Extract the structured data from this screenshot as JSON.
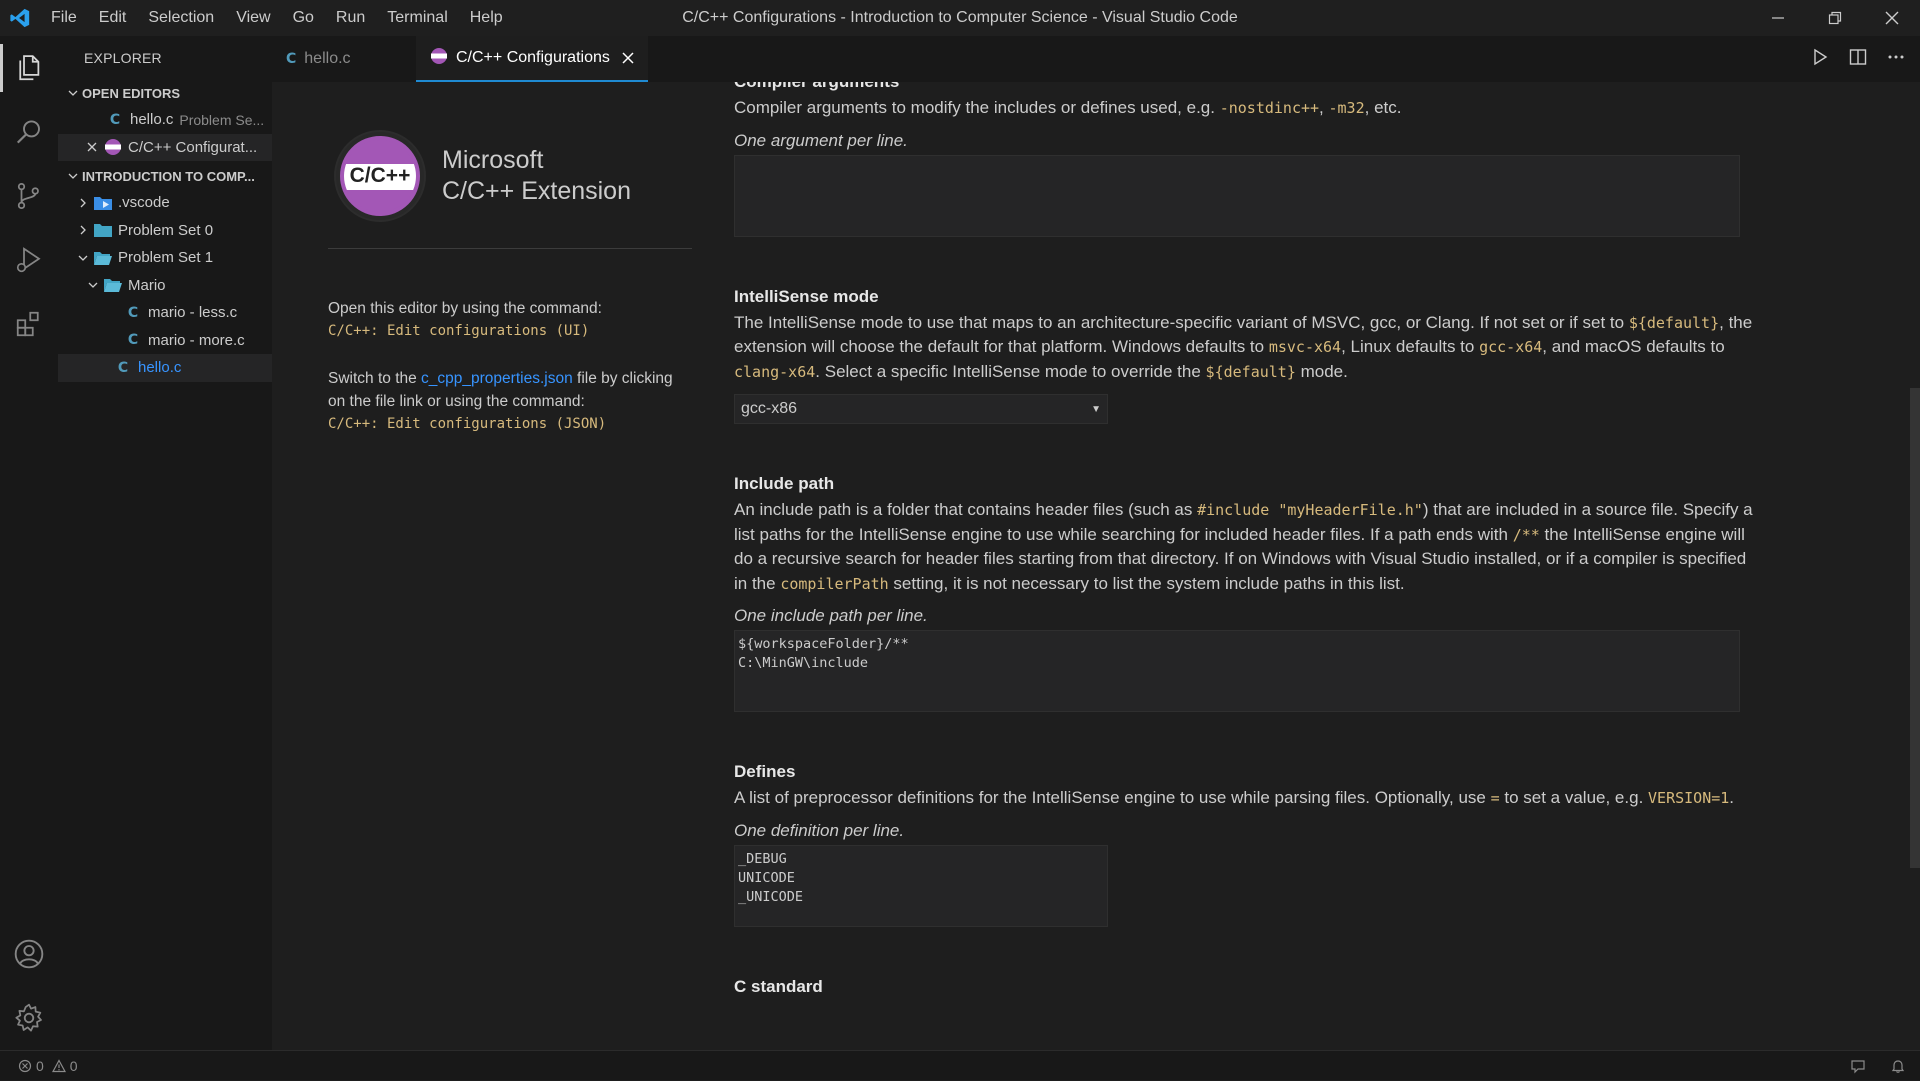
{
  "window": {
    "title": "C/C++ Configurations - Introduction to Computer Science - Visual Studio Code",
    "menu": [
      "File",
      "Edit",
      "Selection",
      "View",
      "Go",
      "Run",
      "Terminal",
      "Help"
    ]
  },
  "sidebar": {
    "title": "EXPLORER",
    "open_editors_header": "OPEN EDITORS",
    "open_editors": [
      {
        "name": "hello.c",
        "detail": "Problem Se..."
      },
      {
        "name": "C/C++ Configurat..."
      }
    ],
    "workspace_header": "INTRODUCTION TO COMP...",
    "tree": [
      {
        "label": ".vscode"
      },
      {
        "label": "Problem Set 0"
      },
      {
        "label": "Problem Set 1"
      },
      {
        "label": "Mario"
      },
      {
        "label": "mario - less.c"
      },
      {
        "label": "mario - more.c"
      },
      {
        "label": "hello.c"
      }
    ]
  },
  "tabs": [
    {
      "label": "hello.c"
    },
    {
      "label": "C/C++ Configurations"
    }
  ],
  "extension": {
    "logo_text": "C/C++",
    "name_line1": "Microsoft",
    "name_line2": "C/C++ Extension",
    "para1": "Open this editor by using the command:",
    "para1_cmd": "C/C++: Edit configurations (UI)",
    "para2_pre": "Switch to the ",
    "para2_link": "c_cpp_properties.json",
    "para2_post": " file by clicking on the file link or using the command:",
    "para2_cmd": "C/C++: Edit configurations (JSON)"
  },
  "settings": {
    "compiler_args": {
      "title": "Compiler arguments",
      "desc_pre": "Compiler arguments to modify the includes or defines used, e.g. ",
      "code1": "-nostdinc++",
      "sep": ", ",
      "code2": "-m32",
      "desc_post": ", etc.",
      "hint": "One argument per line.",
      "value": ""
    },
    "intellisense": {
      "title": "IntelliSense mode",
      "t1": "The IntelliSense mode to use that maps to an architecture-specific variant of MSVC, gcc, or Clang. If not set or if set to ",
      "c1": "${default}",
      "t2": ", the extension will choose the default for that platform. Windows defaults to ",
      "c2": "msvc-x64",
      "t3": ", Linux defaults to ",
      "c3": "gcc-x64",
      "t4": ", and macOS defaults to ",
      "c4": "clang-x64",
      "t5": ". Select a specific IntelliSense mode to override the ",
      "c5": "${default}",
      "t6": " mode.",
      "selected": "gcc-x86"
    },
    "include_path": {
      "title": "Include path",
      "t1": "An include path is a folder that contains header files (such as ",
      "c1": "#include \"myHeaderFile.h\"",
      "t2": ") that are included in a source file. Specify a list paths for the IntelliSense engine to use while searching for included header files. If a path ends with ",
      "c2": "/**",
      "t3": " the IntelliSense engine will do a recursive search for header files starting from that directory. If on Windows with Visual Studio installed, or if a compiler is specified in the ",
      "c3": "compilerPath",
      "t4": " setting, it is not necessary to list the system include paths in this list.",
      "hint": "One include path per line.",
      "value": "${workspaceFolder}/**\nC:\\MinGW\\include"
    },
    "defines": {
      "title": "Defines",
      "t1": "A list of preprocessor definitions for the IntelliSense engine to use while parsing files. Optionally, use ",
      "c1": "=",
      "t2": " to set a value, e.g. ",
      "c2": "VERSION=1",
      "t3": ".",
      "hint": "One definition per line.",
      "value": "_DEBUG\nUNICODE\n_UNICODE"
    },
    "c_standard": {
      "title": "C standard"
    }
  },
  "statusbar": {
    "errors": "0",
    "warnings": "0"
  },
  "colors": {
    "accent": "#1f8ad2",
    "code": "#d7ba7d",
    "link": "#3794ff",
    "ext_logo": "#a357b6"
  }
}
